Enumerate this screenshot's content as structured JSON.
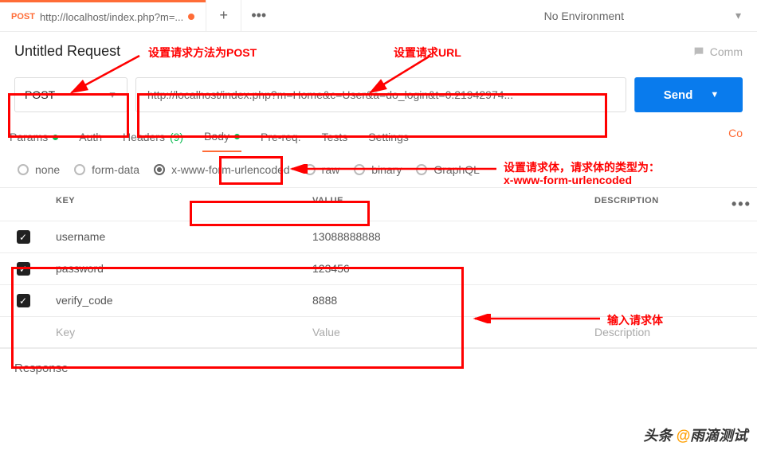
{
  "topbar": {
    "tab_method": "POST",
    "tab_name": "http://localhost/index.php?m=...",
    "new_tab": "+",
    "more": "•••",
    "env": "No Environment"
  },
  "title": "Untitled Request",
  "comment": "Comm",
  "url_row": {
    "method": "POST",
    "url": "http://localhost/index.php?m=Home&c=User&a=do_login&t=0.21942974...",
    "send": "Send"
  },
  "req_tabs": {
    "params": "Params",
    "auth": "Auth",
    "headers": "Headers",
    "headers_count": "(9)",
    "body": "Body",
    "prereq": "Pre-req.",
    "tests": "Tests",
    "settings": "Settings",
    "cookies": "Co"
  },
  "body_sub": {
    "none": "none",
    "formdata": "form-data",
    "urlencoded": "x-www-form-urlencoded",
    "raw": "raw",
    "binary": "binary",
    "graphql": "GraphQL"
  },
  "kv": {
    "head_key": "KEY",
    "head_value": "VALUE",
    "head_desc": "DESCRIPTION",
    "rows": [
      {
        "key": "username",
        "value": "13088888888"
      },
      {
        "key": "password",
        "value": "123456"
      },
      {
        "key": "verify_code",
        "value": "8888"
      }
    ],
    "ph_key": "Key",
    "ph_value": "Value",
    "ph_desc": "Description"
  },
  "response": "Response",
  "annotations": {
    "method": "设置请求方法为POST",
    "url": "设置请求URL",
    "body_type": "设置请求体，请求体的类型为：",
    "body_type2": "x-www-form-urlencoded",
    "input_body": "输入请求体"
  },
  "watermark": {
    "pre": "头条 ",
    "at": "@",
    "post": "雨滴测试"
  }
}
